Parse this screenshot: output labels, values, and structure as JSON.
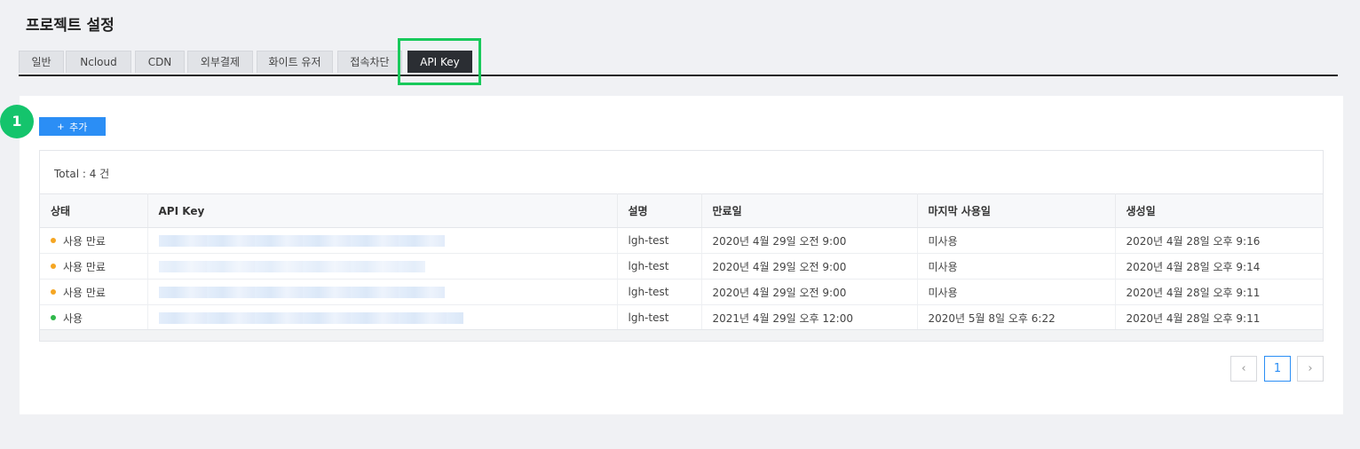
{
  "page": {
    "title": "프로젝트 설정"
  },
  "tabs": [
    {
      "label": "일반"
    },
    {
      "label": "Ncloud"
    },
    {
      "label": "CDN"
    },
    {
      "label": "외부결제"
    },
    {
      "label": "화이트 유저"
    },
    {
      "label": "접속차단"
    },
    {
      "label": "API Key"
    }
  ],
  "active_tab": "API Key",
  "step_badge": "1",
  "toolbar": {
    "add_label": "추가",
    "add_icon": "plus-icon"
  },
  "table": {
    "total": "Total : 4 건",
    "columns": [
      "상태",
      "API Key",
      "설명",
      "만료일",
      "마지막 사용일",
      "생성일"
    ],
    "rows": [
      {
        "status": "사용 만료",
        "status_color": "#f5a623",
        "desc": "lgh-test",
        "expires": "2020년 4월 29일 오전 9:00",
        "last_used": "미사용",
        "created": "2020년 4월 28일 오후 9:16"
      },
      {
        "status": "사용 만료",
        "status_color": "#f5a623",
        "desc": "lgh-test",
        "expires": "2020년 4월 29일 오전 9:00",
        "last_used": "미사용",
        "created": "2020년 4월 28일 오후 9:14"
      },
      {
        "status": "사용 만료",
        "status_color": "#f5a623",
        "desc": "lgh-test",
        "expires": "2020년 4월 29일 오전 9:00",
        "last_used": "미사용",
        "created": "2020년 4월 28일 오후 9:11"
      },
      {
        "status": "사용",
        "status_color": "#2fb84a",
        "desc": "lgh-test",
        "expires": "2021년 4월 29일 오후 12:00",
        "last_used": "2020년 5월 8일 오후 6:22",
        "created": "2020년 4월 28일 오후 9:11"
      }
    ]
  },
  "pagination": {
    "prev": "‹",
    "current": "1",
    "next": "›"
  },
  "colors": {
    "accent": "#2b8ef5",
    "highlight": "#19c95b",
    "badge": "#14c46c",
    "active_tab": "#2b2e33"
  }
}
